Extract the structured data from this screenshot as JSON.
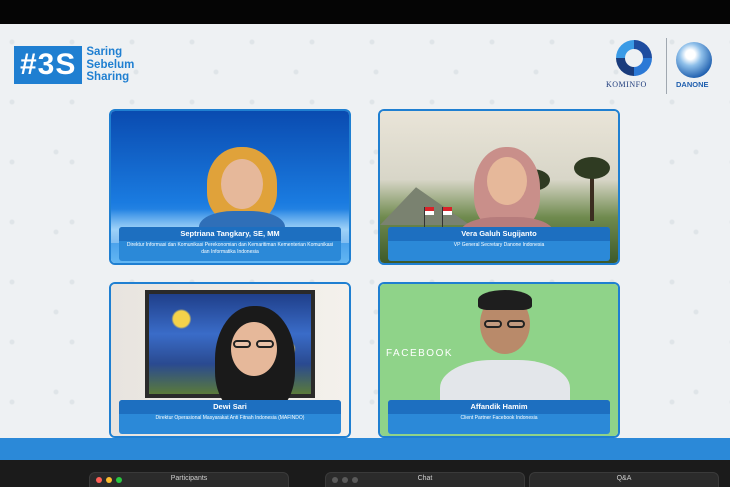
{
  "brand": {
    "hashtag": "#3S",
    "words": [
      "Saring",
      "Sebelum",
      "Sharing"
    ]
  },
  "logos": {
    "kominfo": "KOMINFO",
    "danone": "DANONE"
  },
  "speakers": [
    {
      "name": "Septriana Tangkary, SE, MM",
      "title": "Direktur Informasi dan Komunikasi Perekonomian dan Kemaritiman Kementerian Komunikasi dan Informatika Indonesia",
      "background": "blue"
    },
    {
      "name": "Vera Galuh Sugijanto",
      "title": "VP General Secretary Danone Indonesia",
      "background": "field"
    },
    {
      "name": "Dewi Sari",
      "title": "Direktur Operasional Masyarakat Anti Fitnah Indonesia (MAFINDO)",
      "background": "room"
    },
    {
      "name": "Affandik Hamim",
      "title": "Client Partner Facebook Indonesia",
      "background": "green",
      "backdrop_text": "FACEBOOK"
    }
  ],
  "panels": {
    "participants": "Participants",
    "chat": "Chat",
    "qa": "Q&A"
  },
  "colors": {
    "accent": "#1f7fd1",
    "nameplate": "#2b89d8",
    "facebook_green": "#8fd389"
  }
}
